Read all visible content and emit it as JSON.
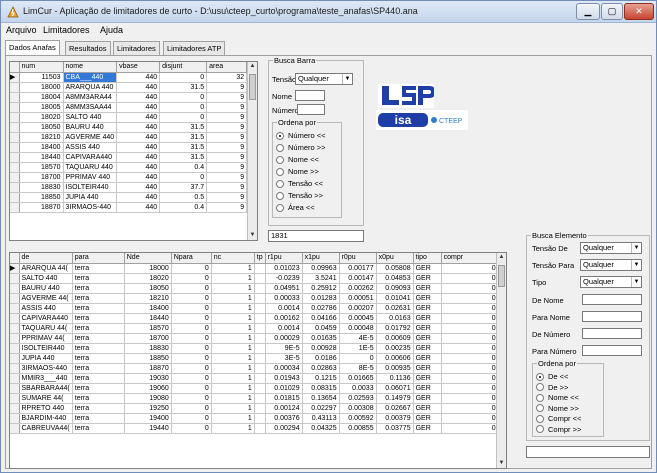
{
  "window": {
    "title": "LimCur - Aplicação de limitadores de curto - D:\\usu\\cteep_curto\\programa\\teste_anafas\\SP440.ana",
    "minimize_icon": "minimize-icon",
    "maximize_icon": "maximize-icon",
    "close_icon": "close-icon"
  },
  "menu": [
    "Arquivo",
    "Limitadores",
    "Ajuda"
  ],
  "tabs": [
    "Dados Anafas",
    "Resultados",
    "Limitadores",
    "Limitadores ATP"
  ],
  "bus_grid": {
    "columns": [
      "num",
      "nome",
      "vbase",
      "disjunt",
      "area"
    ],
    "rows": [
      [
        "11503",
        "CBA___440",
        "440",
        "0",
        "32"
      ],
      [
        "18000",
        "ARARQUA 440",
        "440",
        "31.5",
        "9"
      ],
      [
        "18004",
        "A8MM3ARA44",
        "440",
        "0",
        "9"
      ],
      [
        "18005",
        "A8MM3SAA44",
        "440",
        "0",
        "9"
      ],
      [
        "18020",
        "SALTO   440",
        "440",
        "0",
        "9"
      ],
      [
        "18050",
        "BAURU   440",
        "440",
        "31.5",
        "9"
      ],
      [
        "18210",
        "AGVERME 440",
        "440",
        "31.5",
        "9"
      ],
      [
        "18400",
        "ASSIS   440",
        "440",
        "31.5",
        "9"
      ],
      [
        "18440",
        "CAPIVARA440",
        "440",
        "31.5",
        "9"
      ],
      [
        "18570",
        "TAQUARU 440",
        "440",
        "0.4",
        "9"
      ],
      [
        "18700",
        "PPRIMAV 440",
        "440",
        "0",
        "9"
      ],
      [
        "18830",
        "ISOLTEIR440",
        "440",
        "37.7",
        "9"
      ],
      [
        "18850",
        "JUPIA   440",
        "440",
        "0.5",
        "9"
      ],
      [
        "18870",
        "3IRMAOS-440",
        "440",
        "0.4",
        "9"
      ]
    ]
  },
  "busca_barra": {
    "title": "Busca Barra",
    "tensao_label": "Tensão",
    "tensao_value": "Qualquer",
    "nome_label": "Nome",
    "numero_label": "Número",
    "ordena_title": "Ordena por",
    "options": [
      "Número <<",
      "Número >>",
      "Nome <<",
      "Nome >>",
      "Tensão <<",
      "Tensão >>",
      "Área <<"
    ],
    "selected": 0,
    "count_value": "1831"
  },
  "logos": {
    "lsp_text": "LSP",
    "isa_text": "isa",
    "cteep_text": "CTEEP"
  },
  "element_grid": {
    "columns": [
      "de",
      "para",
      "Nde",
      "Npara",
      "nc",
      "tp",
      "r1pu",
      "x1pu",
      "r0pu",
      "x0pu",
      "tipo",
      "compr"
    ],
    "rows": [
      [
        "ARARQUA 44(",
        "terra",
        "18000",
        "0",
        "1",
        "",
        "0.01023",
        "0.09963",
        "0.00177",
        "0.05808",
        "GER",
        "0"
      ],
      [
        "SALTO   440",
        "terra",
        "18020",
        "0",
        "1",
        "",
        "-0.0239",
        "3.5241",
        "0.00147",
        "0.04853",
        "GER",
        "0"
      ],
      [
        "BAURU   440",
        "terra",
        "18050",
        "0",
        "1",
        "",
        "0.04951",
        "0.25912",
        "0.00262",
        "0.09093",
        "GER",
        "0"
      ],
      [
        "AGVERME 44(",
        "terra",
        "18210",
        "0",
        "1",
        "",
        "0.00033",
        "0.01283",
        "0.00051",
        "0.01041",
        "GER",
        "0"
      ],
      [
        "ASSIS   440",
        "terra",
        "18400",
        "0",
        "1",
        "",
        "0.0014",
        "0.02786",
        "0.00207",
        "0.02631",
        "GER",
        "0"
      ],
      [
        "CAPIVARA440",
        "terra",
        "18440",
        "0",
        "1",
        "",
        "0.00162",
        "0.04166",
        "0.00045",
        "0.0163",
        "GER",
        "0"
      ],
      [
        "TAQUARU 44(",
        "terra",
        "18570",
        "0",
        "1",
        "",
        "0.0014",
        "0.0459",
        "0.00048",
        "0.01792",
        "GER",
        "0"
      ],
      [
        "PPRIMAV 44(",
        "terra",
        "18700",
        "0",
        "1",
        "",
        "0.00029",
        "0.01635",
        "4E-5",
        "0.00609",
        "GER",
        "0"
      ],
      [
        "ISOLTEIR440",
        "terra",
        "18830",
        "0",
        "1",
        "",
        "9E-5",
        "0.00928",
        "1E-5",
        "0.00235",
        "GER",
        "0"
      ],
      [
        "JUPIA   440",
        "terra",
        "18850",
        "0",
        "1",
        "",
        "3E-5",
        "0.0186",
        "0",
        "0.00606",
        "GER",
        "0"
      ],
      [
        "3IRMAOS-440",
        "terra",
        "18870",
        "0",
        "1",
        "",
        "0.00034",
        "0.02863",
        "8E-5",
        "0.00935",
        "GER",
        "0"
      ],
      [
        "MMIR3___440",
        "terra",
        "19030",
        "0",
        "1",
        "",
        "0.01943",
        "0.1215",
        "0.01665",
        "0.1136",
        "GER",
        "0"
      ],
      [
        "SBARBARA44(",
        "terra",
        "19060",
        "0",
        "1",
        "",
        "0.01029",
        "0.08315",
        "0.0033",
        "0.06071",
        "GER",
        "0"
      ],
      [
        "SUMARE  44(",
        "terra",
        "19080",
        "0",
        "1",
        "",
        "0.01815",
        "0.13654",
        "0.02593",
        "0.14979",
        "GER",
        "0"
      ],
      [
        "RPRETO  440",
        "terra",
        "19250",
        "0",
        "1",
        "",
        "0.00124",
        "0.02297",
        "0.00308",
        "0.02667",
        "GER",
        "0"
      ],
      [
        "BJARDIM-440",
        "terra",
        "19400",
        "0",
        "1",
        "",
        "0.00376",
        "0.43113",
        "0.00592",
        "0.00379",
        "GER",
        "0"
      ],
      [
        "CABREUVA44(",
        "terra",
        "19440",
        "0",
        "1",
        "",
        "0.00294",
        "0.04325",
        "0.00855",
        "0.03775",
        "GER",
        "0"
      ]
    ]
  },
  "busca_elemento": {
    "title": "Busca Elemento",
    "tensao_de_label": "Tensão De",
    "tensao_de_value": "Qualquer",
    "tensao_para_label": "Tensão Para",
    "tensao_para_value": "Qualquer",
    "tipo_label": "Tipo",
    "tipo_value": "Qualquer",
    "de_nome_label": "De Nome",
    "para_nome_label": "Para Nome",
    "de_numero_label": "De Número",
    "para_numero_label": "Para Número",
    "ordena_title": "Ordena por",
    "options": [
      "De <<",
      "De >>",
      "Nome <<",
      "Nome >>",
      "Compr <<",
      "Compr >>"
    ],
    "selected": 0
  },
  "colors": {
    "selection": "#3278d6",
    "lsp_blue": "#1f3fa8",
    "cteep_blue": "#2f7fc8"
  }
}
